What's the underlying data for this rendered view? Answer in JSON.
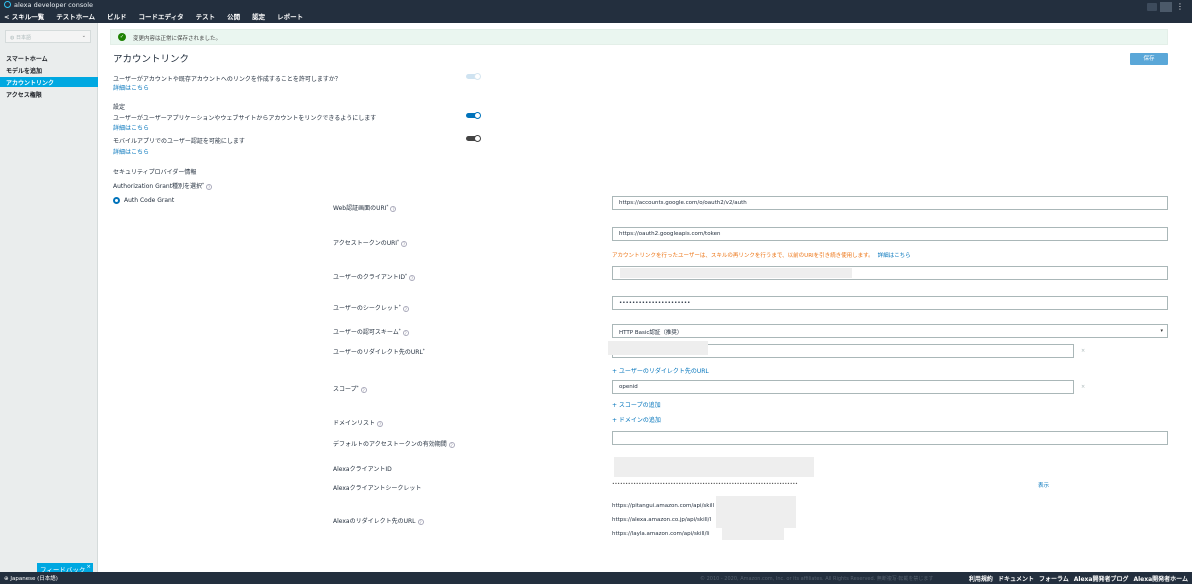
{
  "header": {
    "app_title": "alexa developer console",
    "nav_back": "< スキル一覧",
    "nav_items": [
      "テストホーム",
      "ビルド",
      "コードエディタ",
      "テスト",
      "公開",
      "認定",
      "レポート"
    ],
    "search_icon": "🔍"
  },
  "sidebar": {
    "language": "日本語",
    "items": [
      "スマートホーム",
      "モデルを追加",
      "アカウントリンク",
      "アクセス権限"
    ]
  },
  "banner": {
    "message": "変更内容は正常に保存されました。"
  },
  "page": {
    "title": "アカウントリンク",
    "save_label": "保存",
    "allow_link_text": "ユーザーがアカウントや既存アカウントへのリンクを作成することを許可しますか？",
    "details_link": "詳細はこちら",
    "settings_heading": "設定",
    "allow_app_link_text": "ユーザーがユーザーアプリケーションやウェブサイトからアカウントをリンクできるようにします",
    "mobile_auth_text": "モバイルアプリでのユーザー認証を可能にします",
    "security_provider_heading": "セキュリティプロバイダー情報",
    "grant_type_label": "Authorization Grant種別を選択",
    "grant_type_value": "Auth Code Grant"
  },
  "form": {
    "auth_uri_label": "Web認証画面のURI",
    "auth_uri_value": "https://accounts.google.com/o/oauth2/v2/auth",
    "token_uri_label": "アクセストークンのURI",
    "token_uri_value": "https://oauth2.googleapis.com/token",
    "token_warning": "アカウントリンクを行ったユーザーは、スキルの再リンクを行うまで、以前のURIを引き続き使用します。",
    "token_warning_link": "詳細はこちら",
    "client_id_label": "ユーザーのクライアントID",
    "client_secret_label": "ユーザーのシークレット",
    "client_secret_value": "••••••••••••••••••••••",
    "auth_scheme_label": "ユーザーの認可スキーム",
    "auth_scheme_value": "HTTP Basic認証（推奨）",
    "redirect_label": "ユーザーのリダイレクト先のURL",
    "add_redirect": "+ ユーザーのリダイレクト先のURL",
    "scope_label": "スコープ",
    "scope_value": "openid",
    "add_scope": "+ スコープの追加",
    "domain_label": "ドメインリスト",
    "add_domain": "+ ドメインの追加",
    "default_token_label": "デフォルトのアクセストークンの有効期間",
    "alexa_client_id_label": "AlexaクライアントID",
    "alexa_secret_label": "Alexaクライアントシークレット",
    "alexa_secret_value": "••••••••••••••••••••••••••••••••••••••••••••••••••••••••••••••••••••••",
    "show_label": "表示",
    "alexa_redirect_label": "Alexaのリダイレクト先のURL",
    "alexa_redirect_urls": [
      "https://pitangui.amazon.com/api/skill",
      "https://alexa.amazon.co.jp/api/skill/l",
      "https://layla.amazon.com/api/skill/li"
    ]
  },
  "footer": {
    "language": "Japanese (日本語)",
    "copyright": "© 2010 - 2020, Amazon.com, Inc. or its affiliates. All Rights Reserved. 無断複写·転載を禁じます",
    "links": [
      "利用規約",
      "ドキュメント",
      "フォーラム",
      "Alexa開発者ブログ",
      "Alexa開発者ホーム"
    ],
    "feedback": "フィードバック"
  },
  "colors": {
    "accent": "#00a8e1",
    "link": "#0073bb",
    "warning": "#ec7211",
    "topbar": "#232f3e"
  }
}
